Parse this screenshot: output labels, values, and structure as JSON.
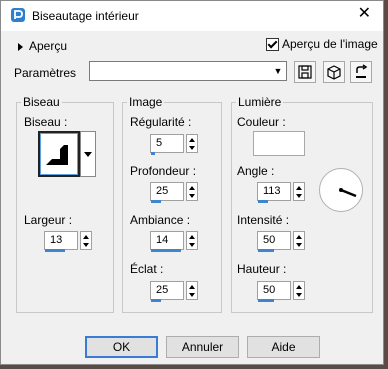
{
  "window": {
    "title": "Biseautage intérieur",
    "close_glyph": "✕"
  },
  "preview": {
    "label": "Aperçu",
    "image_checkbox_label": "Aperçu de l'image",
    "image_checked": true
  },
  "presets": {
    "label": "Paramètres",
    "value": ""
  },
  "groups": {
    "biseau": {
      "title": "Biseau",
      "shape_label": "Biseau :",
      "width_label": "Largeur :",
      "width_value": "13"
    },
    "image": {
      "title": "Image",
      "regularity_label": "Régularité :",
      "regularity_value": "5",
      "depth_label": "Profondeur :",
      "depth_value": "25",
      "ambience_label": "Ambiance :",
      "ambience_value": "14",
      "shine_label": "Éclat :",
      "shine_value": "25"
    },
    "lumiere": {
      "title": "Lumière",
      "color_label": "Couleur :",
      "color_value": "#ffffff",
      "angle_label": "Angle :",
      "angle_value": "113",
      "intensity_label": "Intensité :",
      "intensity_value": "50",
      "height_label": "Hauteur :",
      "height_value": "50"
    }
  },
  "buttons": {
    "ok": "OK",
    "cancel": "Annuler",
    "help": "Aide"
  },
  "colors": {
    "accent": "#3f84ce",
    "background": "#f0f0f0"
  }
}
